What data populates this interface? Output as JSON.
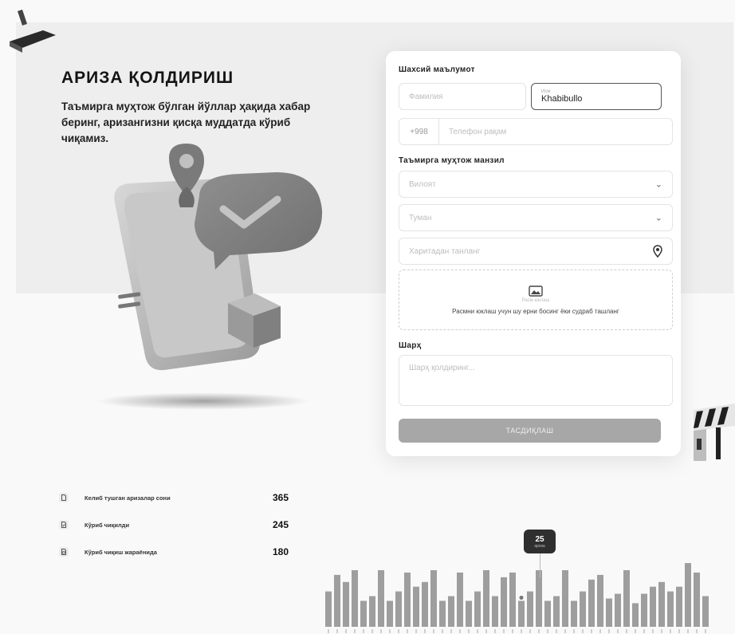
{
  "hero": {
    "title": "АРИЗА ҚОЛДИРИШ",
    "subtitle": "Таъмирга муҳтож бўлган йўллар ҳақида хабар беринг, аризангизни қисқа муддатда кўриб чиқамиз."
  },
  "form": {
    "personal_label": "Шахсий маълумот",
    "lastname_placeholder": "Фамилия",
    "firstname_tiny_label": "Исм",
    "firstname_value": "Khabibullo",
    "phone_code": "+998",
    "phone_placeholder": "Телефон рақам",
    "address_label": "Таъмирга муҳтож манзил",
    "region_placeholder": "Вилоят",
    "district_placeholder": "Туман",
    "location_placeholder": "Харитадан танланг",
    "upload_tiny": "Расм юклаш",
    "upload_text": "Расмни юклаш учун шу ерни босинг ёки судраб ташланг",
    "comment_label": "Шарҳ",
    "comment_placeholder": "Шарҳ қолдиринг...",
    "submit_label": "ТАСДИҚЛАШ"
  },
  "stats": [
    {
      "icon": "document-icon",
      "label": "Келиб тушган аризалар сони",
      "value": "365"
    },
    {
      "icon": "document-check-icon",
      "label": "Кўриб чиқилди",
      "value": "245"
    },
    {
      "icon": "document-clock-icon",
      "label": "Кўриб чиқиш жараёнида",
      "value": "180"
    }
  ],
  "chart_data": {
    "type": "bar",
    "tooltip": {
      "value": "25",
      "caption": "ариза"
    },
    "highlight_index": 22,
    "ylim": [
      0,
      50
    ],
    "values": [
      30,
      44,
      38,
      48,
      22,
      26,
      48,
      22,
      30,
      46,
      34,
      38,
      48,
      22,
      26,
      46,
      22,
      30,
      48,
      26,
      42,
      46,
      22,
      30,
      48,
      22,
      26,
      48,
      22,
      30,
      40,
      44,
      24,
      28,
      48,
      20,
      28,
      34,
      38,
      30,
      34,
      54,
      46,
      26
    ]
  },
  "colors": {
    "bar": "#9e9e9e",
    "submit": "#a7a7a7",
    "tooltip": "#2f2f2f"
  }
}
